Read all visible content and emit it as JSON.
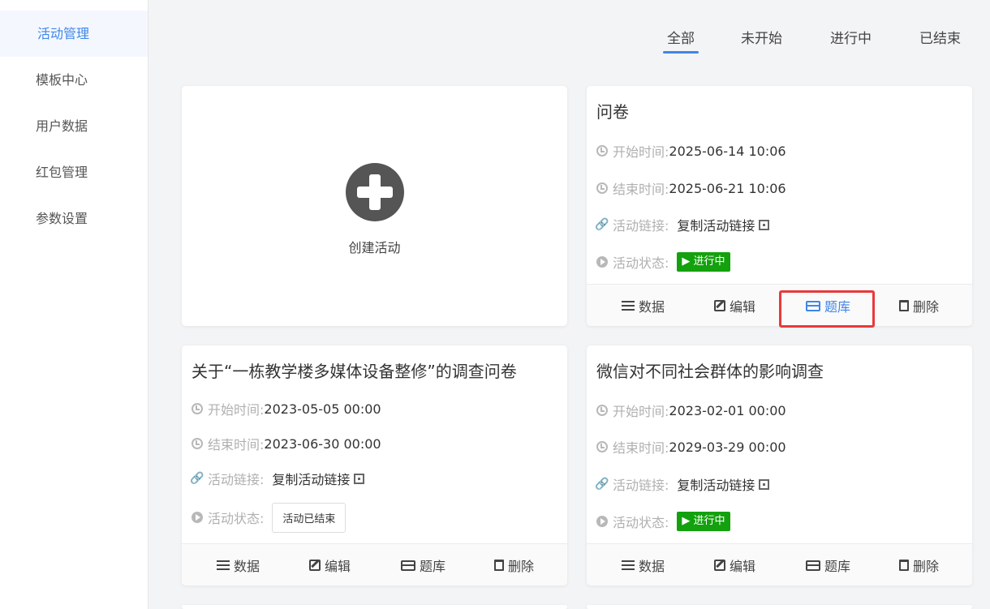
{
  "sidebar": {
    "items": [
      {
        "label": "活动管理"
      },
      {
        "label": "模板中心"
      },
      {
        "label": "用户数据"
      },
      {
        "label": "红包管理"
      },
      {
        "label": "参数设置"
      }
    ]
  },
  "tabs": [
    {
      "label": "全部"
    },
    {
      "label": "未开始"
    },
    {
      "label": "进行中"
    },
    {
      "label": "已结束"
    }
  ],
  "create": {
    "label": "创建活动"
  },
  "labels": {
    "start": "开始时间:",
    "end": "结束时间:",
    "link": "活动链接:",
    "status": "活动状态:",
    "copy_link": "复制活动链接"
  },
  "actions": {
    "data": "数据",
    "edit": "编辑",
    "bank": "题库",
    "delete": "删除"
  },
  "activities": [
    {
      "title": "问卷",
      "start": "2025-06-14 10:06",
      "end": "2025-06-21 10:06",
      "status": "进行中"
    },
    {
      "title": "关于“一栋教学楼多媒体设备整修”的调查问卷",
      "start": "2023-05-05 00:00",
      "end": "2023-06-30 00:00",
      "status": "活动已结束"
    },
    {
      "title": "微信对不同社会群体的影响调查",
      "start": "2023-02-01 00:00",
      "end": "2029-03-29 00:00",
      "status": "进行中"
    }
  ],
  "colors": {
    "accent": "#3f86e8",
    "running": "#13a10e",
    "highlight": "#e8393b"
  }
}
